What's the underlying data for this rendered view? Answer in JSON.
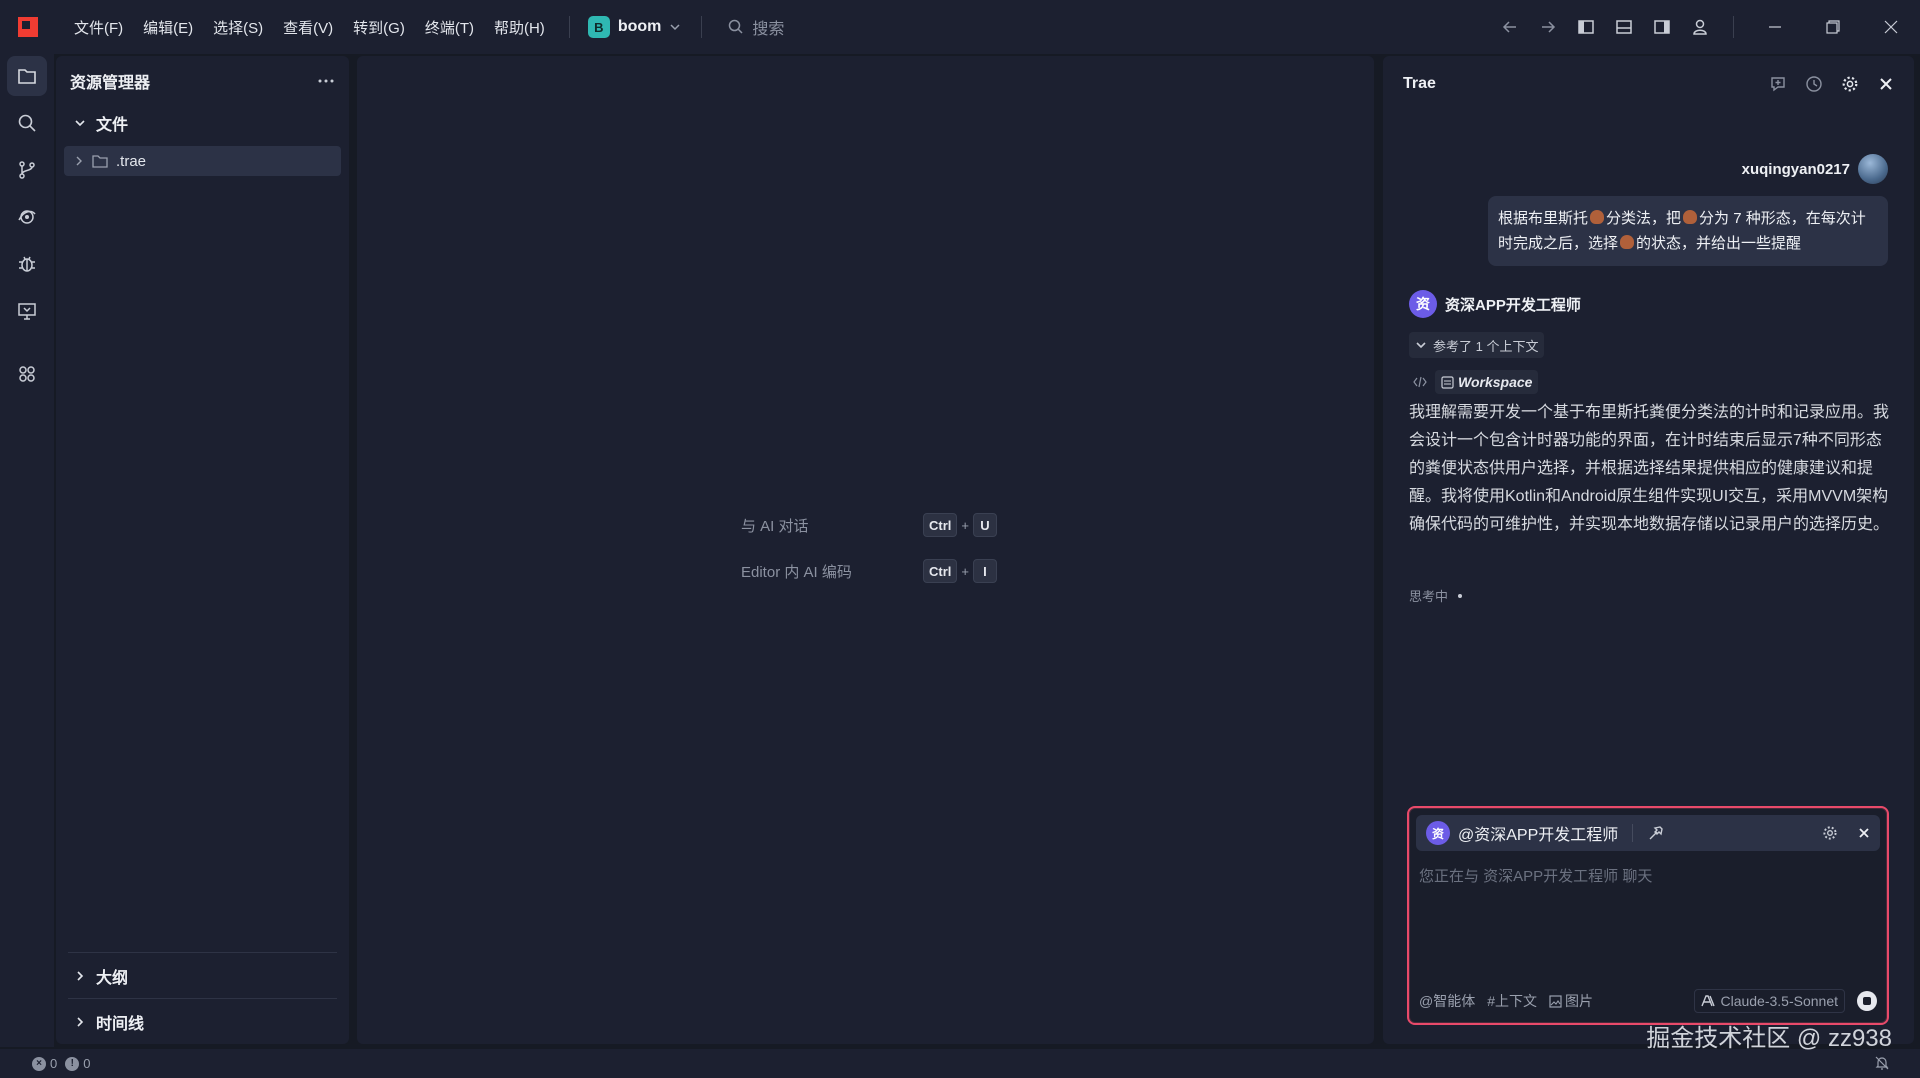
{
  "titlebar": {
    "menu": [
      "文件(F)",
      "编辑(E)",
      "选择(S)",
      "查看(V)",
      "转到(G)",
      "终端(T)",
      "帮助(H)"
    ],
    "project_badge": "B",
    "project_name": "boom",
    "search_placeholder": "搜索"
  },
  "explorer": {
    "title": "资源管理器",
    "files_section": "文件",
    "tree": [
      ".trae"
    ],
    "outline_section": "大纲",
    "timeline_section": "时间线"
  },
  "editor": {
    "shortcuts": [
      {
        "label": "与 AI 对话",
        "key1": "Ctrl",
        "key2": "U"
      },
      {
        "label": "Editor 内 AI 编码",
        "key1": "Ctrl",
        "key2": "I"
      }
    ]
  },
  "chat": {
    "title": "Trae",
    "username": "xuqingyan0217",
    "user_message": {
      "part1": "根据布里斯托",
      "part2": "分类法，把",
      "part3": "分为 7 种形态，在每次计时完成之后，选择",
      "part4": "的状态，并给出一些提醒"
    },
    "agent_avatar": "资",
    "agent_name": "资深APP开发工程师",
    "context_toggle": "参考了 1 个上下文",
    "workspace_chip": "Workspace",
    "agent_message": "我理解需要开发一个基于布里斯托粪便分类法的计时和记录应用。我会设计一个包含计时器功能的界面，在计时结束后显示7种不同形态的粪便状态供用户选择，并根据选择结果提供相应的健康建议和提醒。我将使用Kotlin和Android原生组件实现UI交互，采用MVVM架构确保代码的可维护性，并实现本地数据存储以记录用户的选择历史。",
    "thinking": "思考中",
    "composer": {
      "agent_mention": "@资深APP开发工程师",
      "placeholder": "您正在与 资深APP开发工程师 聊天",
      "agent_btn": "@智能体",
      "context_btn": "#上下文",
      "image_btn": "图片",
      "model": "Claude-3.5-Sonnet"
    }
  },
  "statusbar": {
    "errors": "0",
    "warnings": "0"
  },
  "watermark": "掘金技术社区 @ zz938",
  "colors": {
    "accent_border": "#e94a6a",
    "project_badge": "#2fb8b2",
    "agent_avatar": "#6c5ce7",
    "logo": "#f03c32"
  }
}
